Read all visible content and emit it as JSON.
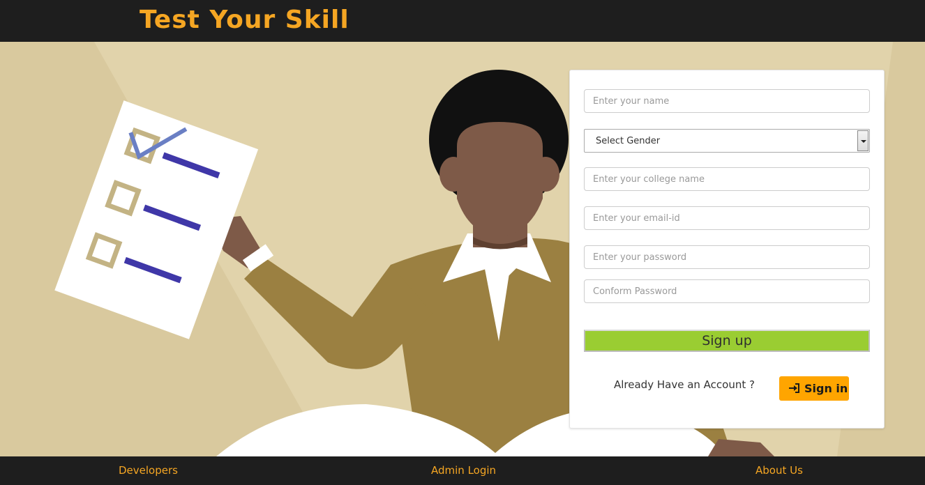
{
  "header": {
    "brand": "Test Your Skill"
  },
  "form": {
    "name_placeholder": "Enter your name",
    "gender_selected": "Select Gender",
    "college_placeholder": "Enter your college name",
    "email_placeholder": "Enter your email-id",
    "password_placeholder": "Enter your password",
    "confirm_placeholder": "Conform Password",
    "signup_label": "Sign up",
    "already_text": "Already Have an Account ?",
    "signin_label": "Sign in"
  },
  "footer": {
    "developers": "Developers",
    "admin_login": "Admin Login",
    "about_us": "About Us"
  },
  "colors": {
    "brand": "#f5a623",
    "signup_bg": "#9acd32",
    "signin_bg": "#ffa500",
    "bar_bg": "#1e1e1e"
  },
  "icons": {
    "signin": "sign-in-icon",
    "dropdown": "chevron-down-icon"
  }
}
